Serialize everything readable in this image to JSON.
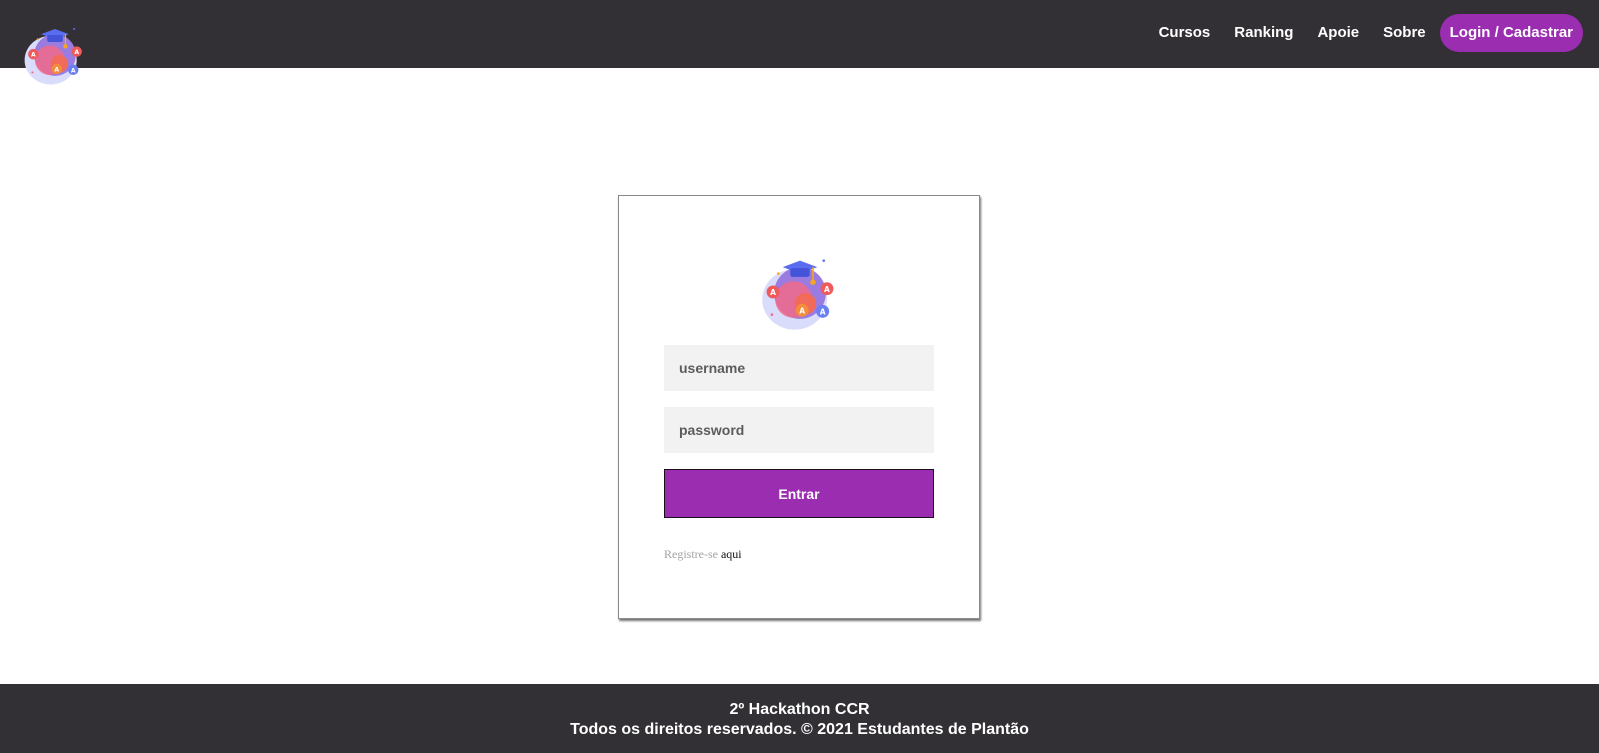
{
  "header": {
    "logo_icon": "graduation-bubble-logo-icon",
    "nav": [
      {
        "label": "Cursos"
      },
      {
        "label": "Ranking"
      },
      {
        "label": "Apoie"
      },
      {
        "label": "Sobre"
      }
    ],
    "cta_label": "Login / Cadastrar"
  },
  "login": {
    "logo_icon": "graduation-bubble-logo-icon",
    "username_placeholder": "username",
    "password_placeholder": "password",
    "submit_label": "Entrar",
    "register_text": "Registre-se",
    "register_link": "aqui"
  },
  "footer": {
    "line1": "2º Hackathon CCR",
    "line2": "Todos os direitos reservados. © 2021 Estudantes de Plantão"
  },
  "colors": {
    "bar": "#323034",
    "accent": "#9b2db0",
    "field_bg": "#f2f2f2"
  }
}
